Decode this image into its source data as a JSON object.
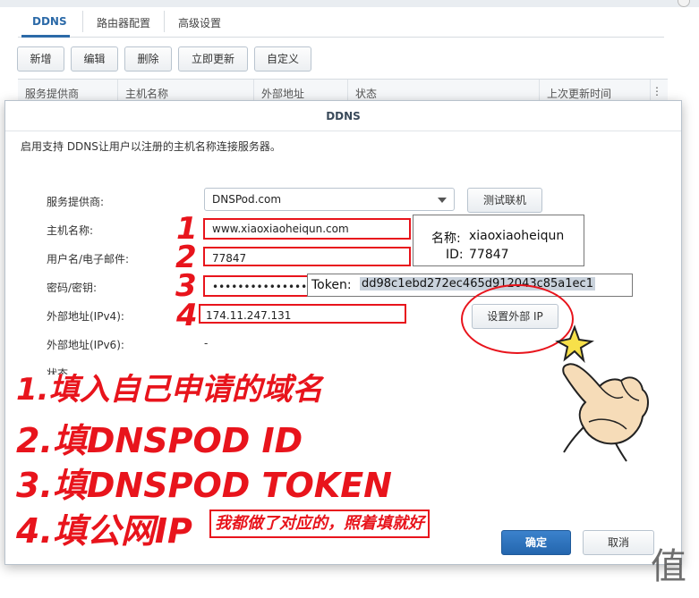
{
  "background_window": {
    "tabs": [
      {
        "label": "DDNS"
      },
      {
        "label": "路由器配置"
      },
      {
        "label": "高级设置"
      }
    ],
    "toolbar": {
      "add": "新增",
      "edit": "编辑",
      "delete": "删除",
      "update_now": "立即更新",
      "custom": "自定义"
    },
    "columns": [
      "服务提供商",
      "主机名称",
      "外部地址",
      "状态",
      "上次更新时间"
    ],
    "more_glyph": "⋮"
  },
  "dialog": {
    "title": "DDNS",
    "description": "启用支持 DDNS让用户以注册的主机名称连接服务器。",
    "provider": {
      "label": "服务提供商:",
      "value": "DNSPod.com"
    },
    "test_button": "测试联机",
    "hostname": {
      "label": "主机名称:",
      "value": "www.xiaoxiaoheiqun.com"
    },
    "username": {
      "label": "用户名/电子邮件:",
      "value": "77847"
    },
    "password": {
      "label": "密码/密钥:",
      "value": "••••••••••••••••••••"
    },
    "ipv4": {
      "label": "外部地址(IPv4):",
      "value": "174.11.247.131"
    },
    "set_ip_button": "设置外部 IP",
    "ipv6": {
      "label": "外部地址(IPv6):",
      "value": "-"
    },
    "status_label_partial": "状态",
    "ok_button": "确定",
    "cancel_button": "取消"
  },
  "annotations": {
    "numbers": [
      "1",
      "2",
      "3",
      "4"
    ],
    "callout_name_label": "名称:",
    "callout_name_value": "xiaoxiaoheiqun",
    "callout_id_label": "ID:",
    "callout_id_value": "77847",
    "token_label": "Token:",
    "token_value": "dd98c1ebd272ec465d912043c85a1ec1",
    "steps": [
      "1.填入自己申请的域名",
      "2.填DNSPOD ID",
      "3.填DNSPOD TOKEN",
      "4.填公网IP"
    ],
    "note": "我都做了对应的，照着填就好",
    "watermark": "值"
  },
  "colors": {
    "annotation_red": "#e8141c",
    "accent_blue": "#2c6aa8",
    "highlight": "#c9d2dc"
  }
}
